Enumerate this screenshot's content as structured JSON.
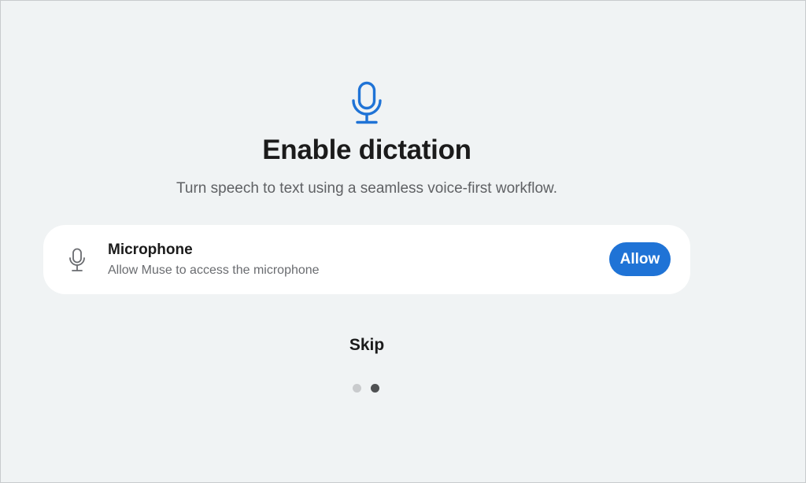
{
  "onboarding": {
    "hero_icon": "microphone-icon",
    "title": "Enable dictation",
    "subtitle": "Turn speech to text using a seamless voice-first workflow.",
    "permission": {
      "icon": "microphone-icon",
      "title": "Microphone",
      "description": "Allow Muse to access the microphone",
      "button_label": "Allow"
    },
    "skip_label": "Skip",
    "pagination": {
      "total": 2,
      "current": 2
    }
  },
  "colors": {
    "background": "#f0f3f4",
    "accent": "#1f73d6",
    "card": "#ffffff",
    "dot_inactive": "#c9cbcd",
    "dot_active": "#4f5153"
  }
}
